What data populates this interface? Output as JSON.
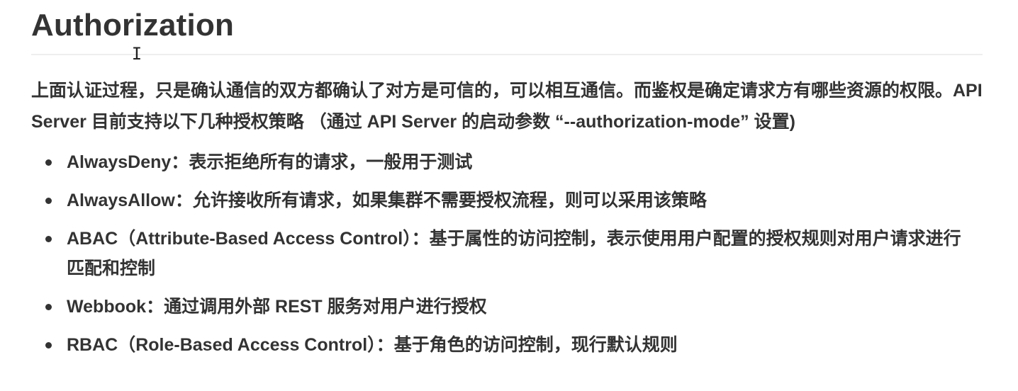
{
  "heading": "Authorization",
  "intro": "上面认证过程，只是确认通信的双方都确认了对方是可信的，可以相互通信。而鉴权是确定请求方有哪些资源的权限。API Server 目前支持以下几种授权策略 （通过 API Server 的启动参数 “--authorization-mode” 设置)",
  "policies": [
    {
      "name": "AlwaysDeny",
      "separator": "：",
      "description": "表示拒绝所有的请求，一般用于测试"
    },
    {
      "name": "AlwaysAllow",
      "separator": "：",
      "description": "允许接收所有请求，如果集群不需要授权流程，则可以采用该策略"
    },
    {
      "name": "ABAC（Attribute-Based Access Control）",
      "separator": "：",
      "description": "基于属性的访问控制，表示使用用户配置的授权规则对用户请求进行匹配和控制"
    },
    {
      "name": "Webbook",
      "separator": "：",
      "description": "通过调用外部 REST 服务对用户进行授权"
    },
    {
      "name": "RBAC（Role-Based Access Control）",
      "separator": "：",
      "description": "基于角色的访问控制，现行默认规则"
    }
  ]
}
